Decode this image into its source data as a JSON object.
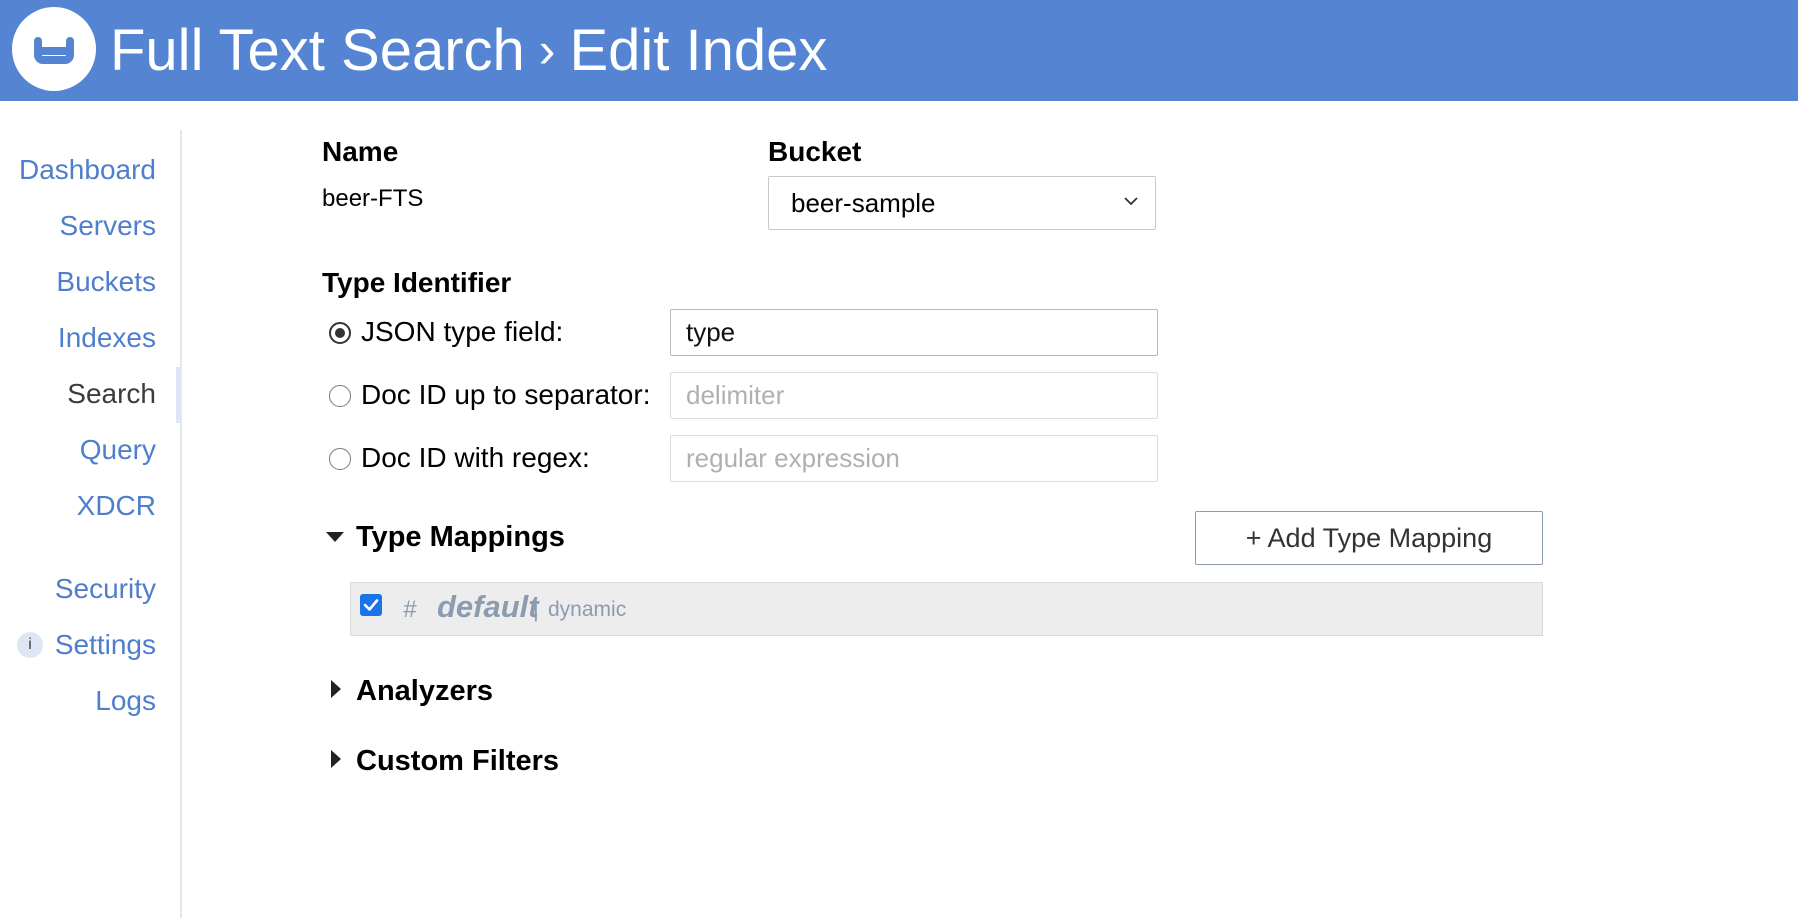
{
  "header": {
    "title_part1": "Full Text Search",
    "separator": "›",
    "title_part2": "Edit Index",
    "background_color": "#5584d2",
    "logo_icon": "couchbase-logo-icon"
  },
  "sidebar": {
    "items": [
      {
        "label": "Dashboard",
        "active": false
      },
      {
        "label": "Servers",
        "active": false
      },
      {
        "label": "Buckets",
        "active": false
      },
      {
        "label": "Indexes",
        "active": false
      },
      {
        "label": "Search",
        "active": true
      },
      {
        "label": "Query",
        "active": false
      },
      {
        "label": "XDCR",
        "active": false
      },
      {
        "label": "Security",
        "active": false
      },
      {
        "label": "Settings",
        "active": false
      },
      {
        "label": "Logs",
        "active": false
      }
    ],
    "info_badge": "i",
    "link_color": "#4f7ecd"
  },
  "form": {
    "name_label": "Name",
    "name_value": "beer-FTS",
    "bucket_label": "Bucket",
    "bucket_selected": "beer-sample",
    "type_identifier_label": "Type Identifier",
    "options": [
      {
        "label": "JSON type field:",
        "checked": true,
        "value": "type",
        "placeholder": ""
      },
      {
        "label": "Doc ID up to separator:",
        "checked": false,
        "value": "",
        "placeholder": "delimiter"
      },
      {
        "label": "Doc ID with regex:",
        "checked": false,
        "value": "",
        "placeholder": "regular expression"
      }
    ]
  },
  "type_mappings": {
    "title": "Type Mappings",
    "expanded": true,
    "add_button_label": "+ Add Type Mapping",
    "rows": [
      {
        "checked": true,
        "hash": "#",
        "name": "default",
        "separator": "|",
        "type": "dynamic"
      }
    ]
  },
  "sections": {
    "analyzers": "Analyzers",
    "custom_filters": "Custom Filters"
  }
}
